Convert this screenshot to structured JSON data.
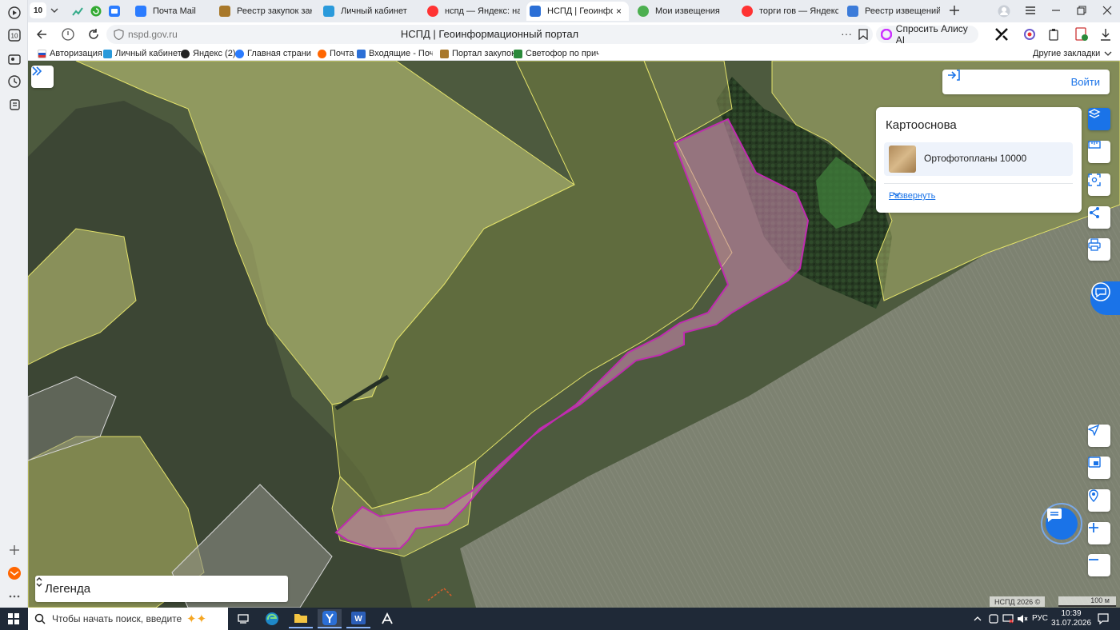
{
  "browser": {
    "tab_counter": "10",
    "tabs": [
      {
        "title": "Почта Mail",
        "color": "#2b7cff"
      },
      {
        "title": "Реестр закупок закры",
        "color": "#a8782a"
      },
      {
        "title": "Личный кабинет",
        "color": "#2a9adb"
      },
      {
        "title": "нспд — Яндекс: нашло",
        "color": "#f33"
      },
      {
        "title": "НСПД | Геоинформ",
        "color": "#2b6fd6"
      },
      {
        "title": "Мои извещения",
        "color": "#4caf50"
      },
      {
        "title": "торги гов — Яндекс: н",
        "color": "#f33"
      },
      {
        "title": "Реестр извещений",
        "color": "#3b7bd9"
      }
    ],
    "url": "nspd.gov.ru",
    "page_title": "НСПД | Геоинформационный портал",
    "alice_label": "Спросить Алису AI",
    "bookmarks": [
      {
        "label": "Авторизация",
        "color": "#d33"
      },
      {
        "label": "Личный кабинет",
        "color": "#2a9adb"
      },
      {
        "label": "Яндекс (2)",
        "color": "#222"
      },
      {
        "label": "Главная страница",
        "color": "#2b7cff"
      },
      {
        "label": "Почта",
        "color": "#f60"
      },
      {
        "label": "Входящие - Почта",
        "color": "#2b6fd6"
      },
      {
        "label": "Портал закупок",
        "color": "#a8782a"
      },
      {
        "label": "Светофор по прич",
        "color": "#2a8a3a"
      }
    ],
    "other_bookmarks": "Другие закладки"
  },
  "map": {
    "login_label": "Войти",
    "basemap_panel": {
      "title": "Картооснова",
      "layer_name": "Ортофотопланы 10000",
      "expand_label": "Развернуть"
    },
    "legend_label": "Легенда",
    "attribution": "НСПД 2026 ©",
    "scale_label": "100 м",
    "tools": [
      "layers-icon",
      "ruler-icon",
      "select-area-icon",
      "share-icon",
      "print-icon"
    ],
    "nav_tools": [
      "locate-icon",
      "minimap-icon",
      "geotag-icon",
      "zoom-in-icon",
      "zoom-out-icon"
    ]
  },
  "taskbar": {
    "search_placeholder": "Чтобы начать поиск, введите",
    "language": "РУС",
    "time": "10:39",
    "date": "31.07.2026"
  }
}
